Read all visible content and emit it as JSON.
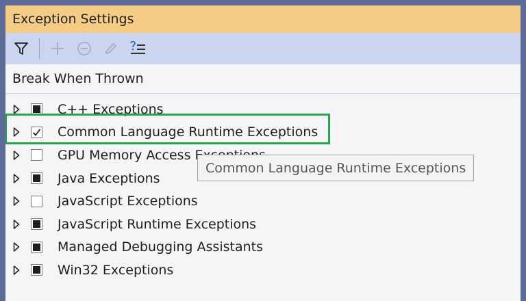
{
  "window": {
    "title": "Exception Settings"
  },
  "toolbar": {
    "buttons": [
      {
        "icon": "filter-icon",
        "enabled": true
      },
      {
        "icon": "add-icon",
        "enabled": false
      },
      {
        "icon": "remove-icon",
        "enabled": false
      },
      {
        "icon": "edit-icon",
        "enabled": false
      },
      {
        "icon": "restore-defaults-icon",
        "enabled": true
      }
    ]
  },
  "list": {
    "header": "Break When Thrown",
    "items": [
      {
        "label": "C++ Exceptions",
        "state": "indeterminate"
      },
      {
        "label": "Common Language Runtime Exceptions",
        "state": "checked"
      },
      {
        "label": "GPU Memory Access Exceptions",
        "state": "unchecked"
      },
      {
        "label": "Java Exceptions",
        "state": "indeterminate"
      },
      {
        "label": "JavaScript Exceptions",
        "state": "unchecked"
      },
      {
        "label": "JavaScript Runtime Exceptions",
        "state": "indeterminate"
      },
      {
        "label": "Managed Debugging Assistants",
        "state": "indeterminate"
      },
      {
        "label": "Win32 Exceptions",
        "state": "indeterminate"
      }
    ]
  },
  "tooltip": {
    "text": "Common Language Runtime Exceptions"
  },
  "colors": {
    "title_bar": "#f5cc84",
    "toolbar": "#ccd5f0",
    "frame": "#5d6b99",
    "highlight": "#22a84a"
  }
}
